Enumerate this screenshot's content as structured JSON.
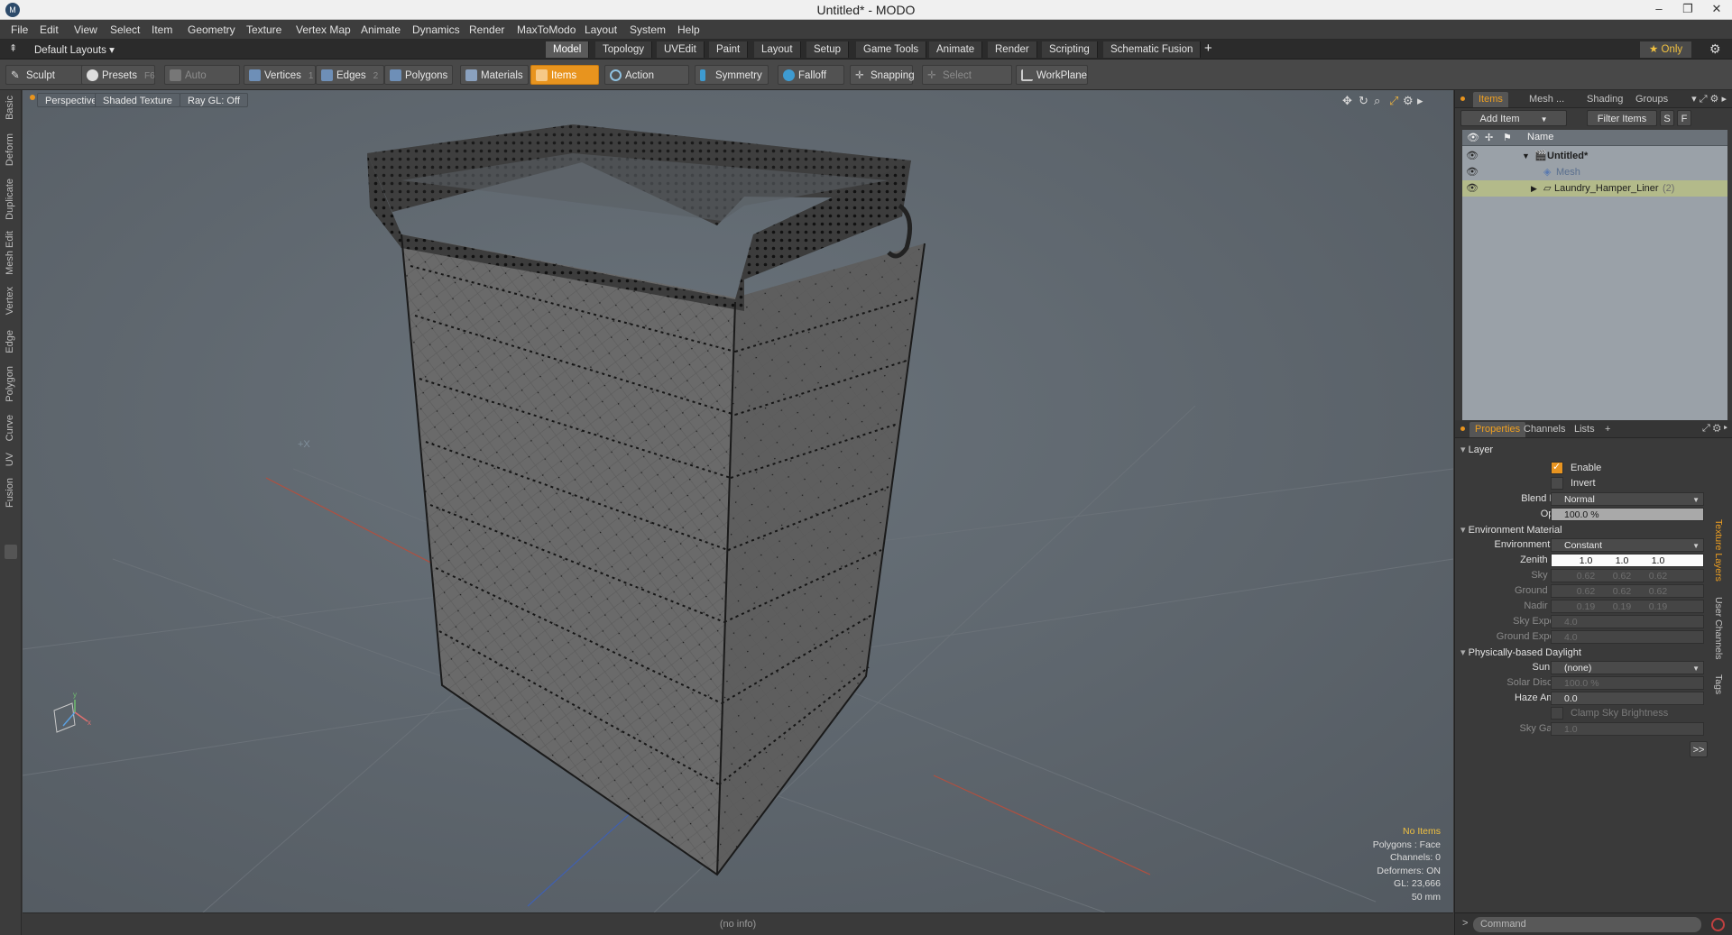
{
  "window": {
    "title": "Untitled* - MODO",
    "logo": "M"
  },
  "menu": [
    "File",
    "Edit",
    "View",
    "Select",
    "Item",
    "Geometry",
    "Texture",
    "Vertex Map",
    "Animate",
    "Dynamics",
    "Render",
    "MaxToModo",
    "Layout",
    "System",
    "Help"
  ],
  "layouts": {
    "default_label": "Default Layouts ▾",
    "tabs": [
      "Model",
      "Topology",
      "UVEdit",
      "Paint",
      "Layout",
      "Setup",
      "Game Tools",
      "Animate",
      "Render",
      "Scripting",
      "Schematic Fusion"
    ],
    "active_tab": "Model",
    "only_label": "★  Only"
  },
  "toolbar": {
    "sculpt": "Sculpt",
    "presets": "Presets",
    "presets_key": "F6",
    "auto_select": "Auto Select",
    "vertices": "Vertices",
    "vertices_key": "1",
    "edges": "Edges",
    "edges_key": "2",
    "polygons": "Polygons",
    "materials": "Materials",
    "items": "Items",
    "action_center": "Action Center",
    "symmetry": "Symmetry",
    "falloff": "Falloff",
    "snapping": "Snapping",
    "select_through": "Select Through",
    "workplane": "WorkPlane"
  },
  "left_tabs": [
    "Basic",
    "Deform",
    "Duplicate",
    "Mesh Edit",
    "Vertex",
    "Edge",
    "Polygon",
    "Curve",
    "UV",
    "Fusion"
  ],
  "viewport": {
    "view": "Perspective",
    "shading": "Shaded Texture",
    "raygl": "Ray GL: Off",
    "stats": {
      "no_items": "No Items",
      "polygons": "Polygons : Face",
      "channels": "Channels: 0",
      "deformers": "Deformers: ON",
      "gl": "GL: 23,666",
      "focal": "50 mm"
    }
  },
  "status": {
    "info": "(no info)"
  },
  "items_panel": {
    "tabs": [
      "Items",
      "Mesh ...",
      "Shading",
      "Groups"
    ],
    "add_item": "Add Item",
    "filter_items": "Filter Items",
    "s_btn": "S",
    "f_btn": "F",
    "col_name": "Name",
    "rows": [
      {
        "label": "Untitled*"
      },
      {
        "label": "Mesh"
      },
      {
        "label": "Laundry_Hamper_Liner",
        "count": "(2)"
      }
    ]
  },
  "properties": {
    "tabs": [
      "Properties",
      "Channels",
      "Lists",
      "+"
    ],
    "layer_header": "Layer",
    "enable": "Enable",
    "invert": "Invert",
    "blend_mode_label": "Blend Mode",
    "blend_mode": "Normal",
    "opacity_label": "Opacity",
    "opacity": "100.0 %",
    "env_header": "Environment Material",
    "env_type_label": "Environment Type",
    "env_type": "Constant",
    "zenith_label": "Zenith Color",
    "zenith": [
      "1.0",
      "1.0",
      "1.0"
    ],
    "sky_label": "Sky Color",
    "sky": [
      "0.62",
      "0.62",
      "0.62"
    ],
    "ground_label": "Ground Color",
    "ground": [
      "0.62",
      "0.62",
      "0.62"
    ],
    "nadir_label": "Nadir Color",
    "nadir": [
      "0.19",
      "0.19",
      "0.19"
    ],
    "sky_exp_label": "Sky Exponent",
    "sky_exp": "4.0",
    "ground_exp_label": "Ground Exponent",
    "ground_exp": "4.0",
    "daylight_header": "Physically-based Daylight",
    "sun_light_label": "Sun Light",
    "sun_light": "(none)",
    "solar_disc_label": "Solar Disc Size",
    "solar_disc": "100.0 %",
    "haze_label": "Haze Amount",
    "haze": "0.0",
    "clamp_sky": "Clamp Sky Brightness",
    "sky_gamma_label": "Sky Gamma",
    "sky_gamma": "1.0",
    "more": ">>"
  },
  "side_vtabs": [
    "Texture Layers",
    "User Channels",
    "Tags"
  ],
  "command": {
    "placeholder": "Command",
    "prompt": ">"
  },
  "colors": {
    "accent": "#e8941e",
    "viewport_bg": "#5d656d"
  }
}
